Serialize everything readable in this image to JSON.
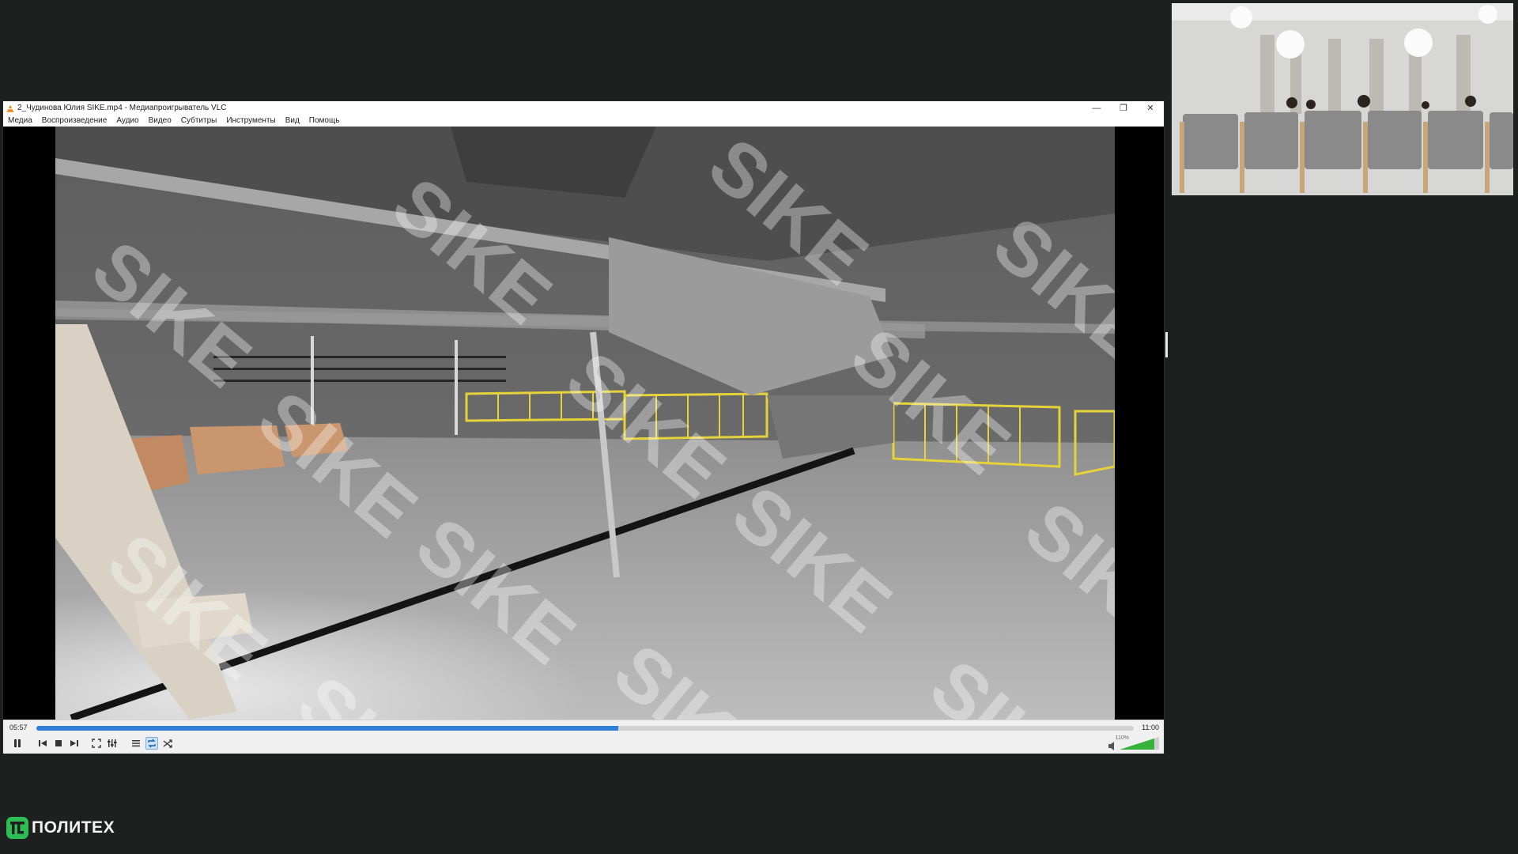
{
  "window": {
    "title": "2_Чудинова Юлия SIKE.mp4 - Медиапроигрыватель VLC",
    "minimize_glyph": "—",
    "maximize_glyph": "❐",
    "close_glyph": "✕"
  },
  "menu": [
    "Медиа",
    "Воспроизведение",
    "Аудио",
    "Видео",
    "Субтитры",
    "Инструменты",
    "Вид",
    "Помощь"
  ],
  "video": {
    "watermark": "SIKE"
  },
  "controls": {
    "time_current": "05:57",
    "time_total": "11:00",
    "progress": 0.53,
    "volume_label": "110%",
    "volume_level": 1.1,
    "buttons": [
      {
        "name": "pause-button",
        "icon": "pause-icon"
      },
      {
        "name": "previous-button",
        "icon": "skip-back-icon"
      },
      {
        "name": "stop-button",
        "icon": "stop-icon"
      },
      {
        "name": "next-button",
        "icon": "skip-forward-icon"
      },
      {
        "name": "fullscreen-button",
        "icon": "fullscreen-icon"
      },
      {
        "name": "extended-settings-button",
        "icon": "equalizer-icon"
      },
      {
        "name": "playlist-button",
        "icon": "playlist-icon"
      },
      {
        "name": "loop-button",
        "icon": "loop-icon",
        "active": true
      },
      {
        "name": "shuffle-button",
        "icon": "shuffle-icon"
      }
    ]
  },
  "branding": {
    "logo_text": "ПОЛИТЕХ",
    "accent": "#2ebd55"
  },
  "colors": {
    "seek_fill": "#2f7fd6",
    "railing": "#e6d23a",
    "background": "#1e1f1f"
  }
}
